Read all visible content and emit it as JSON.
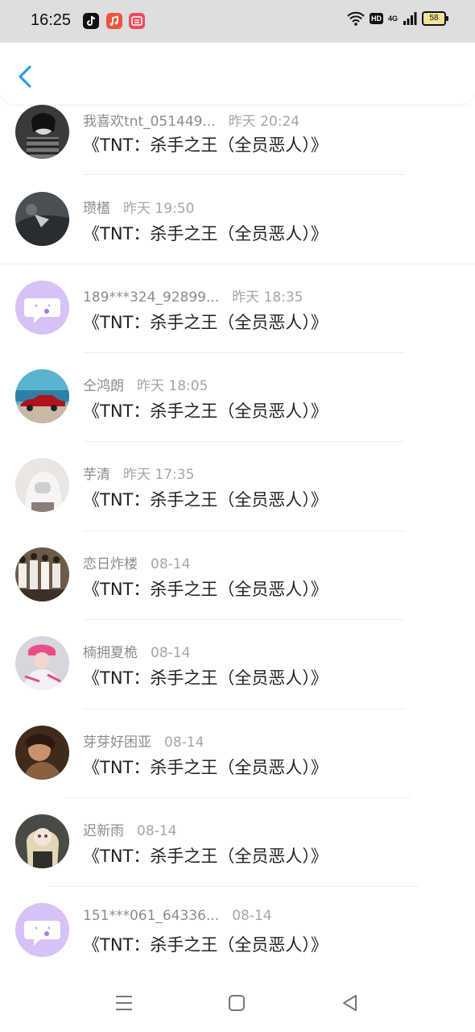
{
  "status_bar": {
    "time": "16:25",
    "apps": [
      {
        "icon": "tiktok-icon",
        "color": "#111111"
      },
      {
        "icon": "music-app-icon",
        "color": "#f0533c"
      },
      {
        "icon": "xiaohongshu-style-icon",
        "color": "#ef4a5c"
      }
    ],
    "hd_label": "HD",
    "network_label": "4G",
    "battery_level": "58"
  },
  "header": {
    "back_icon": "chevron-left-icon",
    "accent": "#2f9cf0"
  },
  "messages": [
    {
      "name": "我喜欢tnt_051449...",
      "date": "昨天 20:24",
      "text": "《TNT：杀手之王（全员恶人）》",
      "avatar": "photo-girl-bw"
    },
    {
      "name": "瓒㯼",
      "date": "昨天 19:50",
      "text": "《TNT：杀手之王（全员恶人）》",
      "avatar": "photo-dark-grey"
    },
    {
      "name": "189***324_92899...",
      "date": "昨天 18:35",
      "text": "《TNT：杀手之王（全员恶人）》",
      "avatar": "default-chat-avatar"
    },
    {
      "name": "仝鸿朗",
      "date": "昨天 18:05",
      "text": "《TNT：杀手之王（全员恶人）》",
      "avatar": "photo-red-car"
    },
    {
      "name": "芋清",
      "date": "昨天 17:35",
      "text": "《TNT：杀手之王（全员恶人）》",
      "avatar": "photo-hooded-girl"
    },
    {
      "name": "恋日炸楼",
      "date": "08-14",
      "text": "《TNT：杀手之王（全员恶人）》",
      "avatar": "photo-group"
    },
    {
      "name": "楠拥夏桅",
      "date": "08-14",
      "text": "《TNT：杀手之王（全员恶人）》",
      "avatar": "photo-pink-cap"
    },
    {
      "name": "芽芽好困亚",
      "date": "08-14",
      "text": "《TNT：杀手之王（全员恶人）》",
      "avatar": "photo-warm-brown"
    },
    {
      "name": "迟新雨",
      "date": "08-14",
      "text": "《TNT：杀手之王（全员恶人）》",
      "avatar": "photo-doll"
    },
    {
      "name": "151***061_64336...",
      "date": "08-14",
      "text": "《TNT：杀手之王（全员恶人）》",
      "avatar": "default-chat-avatar"
    }
  ],
  "nav": {
    "menu_icon": "menu-icon",
    "home_icon": "home-square-icon",
    "back_icon": "back-triangle-icon"
  }
}
